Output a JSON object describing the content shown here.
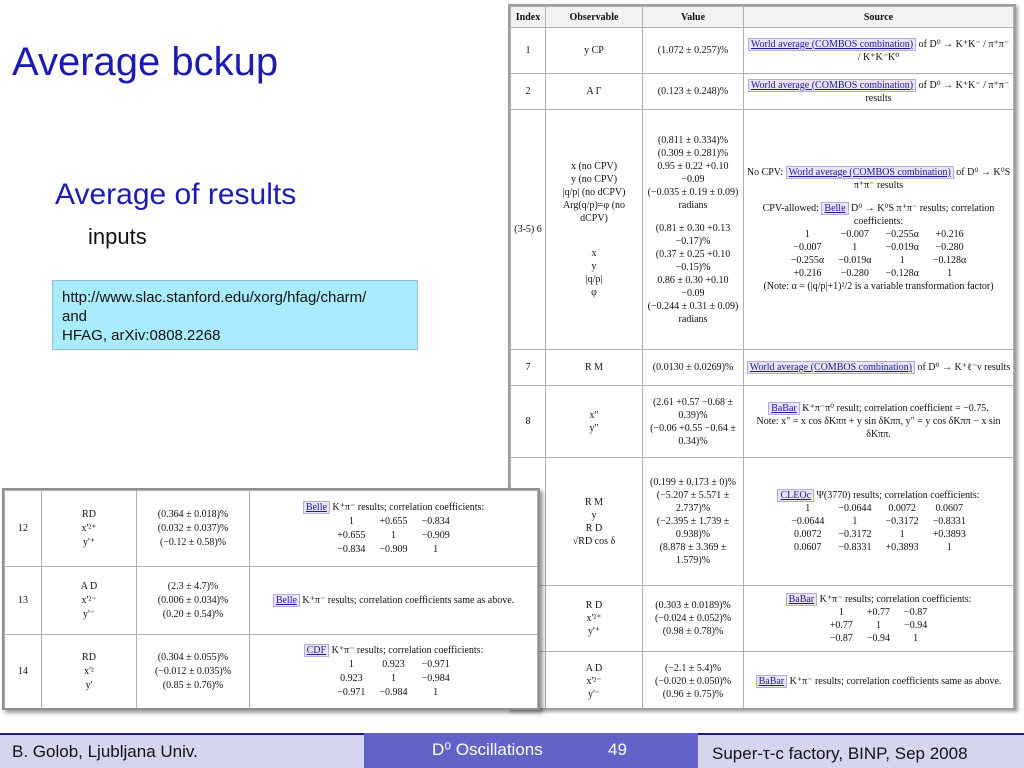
{
  "slide": {
    "title": "Average bckup",
    "subtitle": "Average of results",
    "inputs_label": "inputs",
    "links": [
      "http://www.slac.stanford.edu/xorg/hfag/charm/",
      "and",
      "HFAG, arXiv:0808.2268"
    ]
  },
  "main_table": {
    "headers": [
      "Index",
      "Observable",
      "Value",
      "Source"
    ],
    "rows": [
      {
        "index": "1",
        "observable": "y CP",
        "value": "(1.072 ± 0.257)%",
        "source_link": "World average (COMBOS combination)",
        "source_text": "of D⁰ → K⁺K⁻ / π⁺π⁻ / K⁺K⁻K⁰"
      },
      {
        "index": "2",
        "observable": "A Γ",
        "value": "(0.123 ± 0.248)%",
        "source_link": "World average (COMBOS combination)",
        "source_text": "of D⁰ → K⁺K⁻ / π⁺π⁻ results"
      },
      {
        "index": "(3-5) 6",
        "obs_top": [
          "x (no CPV)",
          "y (no CPV)",
          "|q/p| (no dCPV)",
          "Arg(q/p)=φ (no dCPV)"
        ],
        "obs_bottom": [
          "x",
          "y",
          "|q/p|",
          "φ"
        ],
        "val_top": [
          "(0.811 ± 0.334)%",
          "(0.309 ± 0.281)%",
          "0.95 ± 0.22 +0.10 −0.09",
          "(−0.035 ± 0.19 ± 0.09) radians"
        ],
        "val_bottom": [
          "(0.81 ± 0.30 +0.13 −0.17)%",
          "(0.37 ± 0.25 +0.10 −0.15)%",
          "0.86 ± 0.30 +0.10 −0.09",
          "(−0.244 ± 0.31 ± 0.09) radians"
        ],
        "nocpv_label": "No CPV:",
        "nocpv_link": "World average (COMBOS combination)",
        "nocpv_text": "of D⁰ → K⁰S π⁺π⁻ results",
        "cpv_label": "CPV-allowed:",
        "cpv_link": "Belle",
        "cpv_text": "D⁰ → K⁰S π⁺π⁻ results; correlation coefficients:",
        "matrix": [
          "1",
          "−0.007",
          "−0.255α",
          "+0.216",
          "−0.007",
          "1",
          "−0.019α",
          "−0.280",
          "−0.255α",
          "−0.019α",
          "1",
          "−0.128α",
          "+0.216",
          "−0.280",
          "−0.128α",
          "1"
        ],
        "note": "(Note: α = (|q/p|+1)²/2 is a variable transformation factor)"
      },
      {
        "index": "7",
        "observable": "R M",
        "value": "(0.0130 ± 0.0269)%",
        "source_link": "World average (COMBOS combination)",
        "source_text": "of D⁰ → K⁺ℓ⁻ν results"
      },
      {
        "index": "8",
        "observables": [
          "x\"",
          "y\""
        ],
        "values": [
          "(2.61 +0.57 −0.68 ± 0.39)%",
          "(−0.06 +0.55 −0.64 ± 0.34)%"
        ],
        "source_link": "BaBar",
        "source_text": "K⁺π⁻π⁰ result; correlation coefficient = −0.75.",
        "source_note": "Note: x\" = x cos δKππ + y sin δKππ,  y\" = y cos δKππ − x sin δKππ."
      },
      {
        "index": "",
        "observables": [
          "R M",
          "y",
          "R D",
          "√RD cos δ"
        ],
        "values": [
          "(0.199 ± 0.173 ± 0)%",
          "(−5.207 ± 5.571 ± 2.737)%",
          "(−2.395 ± 1.739 ± 0.938)%",
          "(8.878 ± 3.369 ± 1.579)%"
        ],
        "source_link": "CLEOc",
        "source_text": "Ψ(3770) results; correlation coefficients:",
        "matrix": [
          "1",
          "−0.0644",
          "0.0072",
          "0.0607",
          "−0.0644",
          "1",
          "−0.3172",
          "−0.8331",
          "0.0072",
          "−0.3172",
          "1",
          "+0.3893",
          "0.0607",
          "−0.8331",
          "+0.3893",
          "1"
        ]
      },
      {
        "index": "",
        "observables": [
          "R D",
          "x'²⁺",
          "y'⁺"
        ],
        "values": [
          "(0.303 ± 0.0189)%",
          "(−0.024 ± 0.052)%",
          "(0.98 ± 0.78)%"
        ],
        "source_link": "BaBar",
        "source_text": "K⁺π⁻ results; correlation coefficients:",
        "matrix": [
          "1",
          "+0.77",
          "−0.87",
          "+0.77",
          "1",
          "−0.94",
          "−0.87",
          "−0.94",
          "1"
        ]
      },
      {
        "index": "",
        "observables": [
          "A D",
          "x'²⁻",
          "y'⁻"
        ],
        "values": [
          "(−2.1 ± 5.4)%",
          "(−0.020 ± 0.050)%",
          "(0.96 ± 0.75)%"
        ],
        "source_link": "BaBar",
        "source_text": "K⁺π⁻ results; correlation coefficients same as above."
      }
    ]
  },
  "overlay_table": {
    "rows": [
      {
        "index": "12",
        "observables": [
          "RD",
          "x'²⁺",
          "y'⁺"
        ],
        "values": [
          "(0.364 ± 0.018)%",
          "(0.032 ± 0.037)%",
          "(−0.12 ± 0.58)%"
        ],
        "source_link": "Belle",
        "source_text": "K⁺π⁻ results; correlation coefficients:",
        "matrix": [
          "1",
          "+0.655",
          "−0.834",
          "+0.655",
          "1",
          "−0.909",
          "−0.834",
          "−0.909",
          "1"
        ]
      },
      {
        "index": "13",
        "observables": [
          "A D",
          "x'²⁻",
          "y'⁻"
        ],
        "values": [
          "(2.3 ± 4.7)%",
          "(0.006 ± 0.034)%",
          "(0.20 ± 0.54)%"
        ],
        "source_link": "Belle",
        "source_text": "K⁺π⁻ results; correlation coefficients same as above."
      },
      {
        "index": "14",
        "observables": [
          "RD",
          "x'²",
          "y'"
        ],
        "values": [
          "(0.304 ± 0.055)%",
          "(−0.012 ± 0.035)%",
          "(0.85 ± 0.76)%"
        ],
        "source_link": "CDF",
        "source_text": "K⁺π⁻ results; correlation coefficients:",
        "matrix": [
          "1",
          "0.923",
          "−0.971",
          "0.923",
          "1",
          "−0.984",
          "−0.971",
          "−0.984",
          "1"
        ]
      }
    ]
  },
  "footer": {
    "left": "B. Golob, Ljubljana Univ.",
    "middle": "D⁰ Oscillations",
    "page": "49",
    "right": "Super-τ-c factory, BINP, Sep 2008"
  },
  "colors": {
    "title": "#1c1cb4",
    "linkbox": "#a8ecfd",
    "footer_band": "#d5d5f0",
    "footer_mid": "#6262c8",
    "link": "#1a1aa0"
  }
}
